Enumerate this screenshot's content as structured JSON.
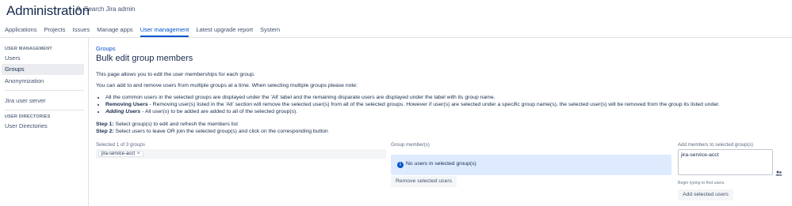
{
  "header": {
    "title": "Administration",
    "search_label": "Search Jira admin"
  },
  "tabs": [
    {
      "label": "Applications",
      "active": false
    },
    {
      "label": "Projects",
      "active": false
    },
    {
      "label": "Issues",
      "active": false
    },
    {
      "label": "Manage apps",
      "active": false
    },
    {
      "label": "User management",
      "active": true
    },
    {
      "label": "Latest upgrade report",
      "active": false
    },
    {
      "label": "System",
      "active": false
    }
  ],
  "sidebar": {
    "section1_heading": "USER MANAGEMENT",
    "items": [
      {
        "label": "Users"
      },
      {
        "label": "Groups"
      },
      {
        "label": "Anonymization"
      },
      {
        "label": "Jira user server"
      },
      {
        "label": "User Directories"
      }
    ],
    "section2_heading": "USER DIRECTORIES"
  },
  "main": {
    "breadcrumb": "Groups",
    "title": "Bulk edit group members",
    "intro": "This page allows you to edit the user memberships for each group.",
    "note": "You can add to and remove users from multiple groups at a time. When selecting multiple groups please note:",
    "bullet1": "All the common users in the selected groups are displayed under the 'All' label and the remaining disparate users are displayed under the label with its group name.",
    "bullet2_bold": "Removing Users",
    "bullet2_text": " - Removing user(s) listed in the 'All' section will remove the selected user(s) from all of the selected groups. However if user(s) are selected under a specific group name(s), the selected user(s) will be removed from the group its listed under.",
    "bullet3_bold": "Adding Users",
    "bullet3_text": " - All user(s) to be added are added to all of the selected group(s).",
    "step1_bold": "Step 1:",
    "step1_text": " Select group(s) to edit and refresh the members list",
    "step2_bold": "Step 2:",
    "step2_text": " Select users to leave OR join the selected group(s) and click on the corresponding button"
  },
  "groups": {
    "label": "Selected 1 of 3 groups",
    "selected_chip": "jira-service-acct",
    "remove_chip_glyph": "×"
  },
  "members": {
    "label": "Group member(s)",
    "info_icon_glyph": "i",
    "empty_message": "No users in selected group(s)",
    "remove_button": "Remove selected users"
  },
  "add": {
    "label": "Add members to selected group(s)",
    "textarea_value": "jira-service-acct",
    "hint": "Begin typing to find users.",
    "add_button": "Add selected users"
  },
  "colors": {
    "accent": "#0052cc",
    "info_bg": "#deebff"
  }
}
